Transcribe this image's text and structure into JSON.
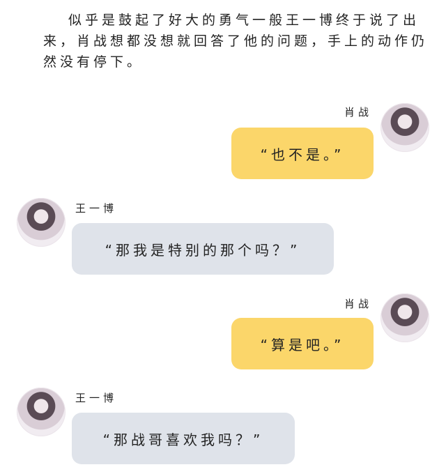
{
  "narration": "似乎是鼓起了好大的勇气一般王一博终于说了出来，肖战想都没想就回答了他的问题，手上的动作仍然没有停下。",
  "messages": [
    {
      "speaker": "肖战",
      "text": "“也不是。”"
    },
    {
      "speaker": "王一博",
      "text": "“那我是特别的那个吗？”"
    },
    {
      "speaker": "肖战",
      "text": "“算是吧。”"
    },
    {
      "speaker": "王一博",
      "text": "“那战哥喜欢我吗？”"
    }
  ]
}
